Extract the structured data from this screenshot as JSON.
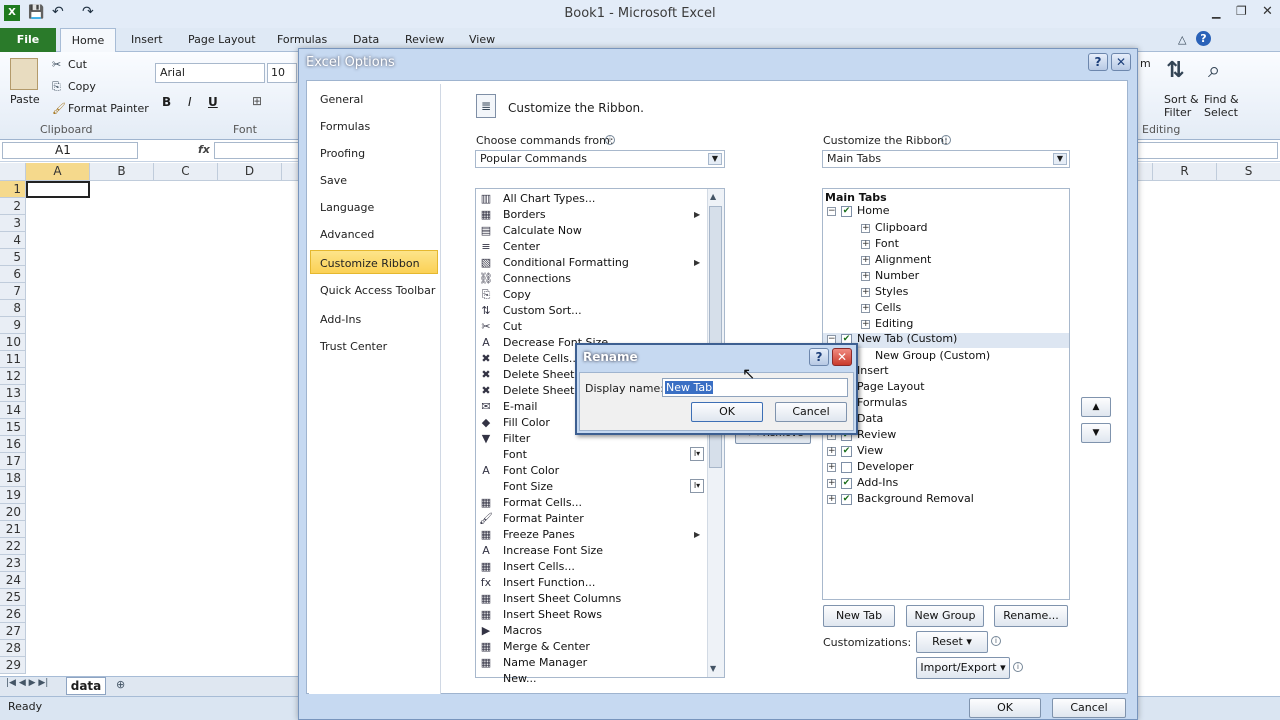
{
  "app": {
    "title": "Book1 - Microsoft Excel",
    "tabs": [
      "File",
      "Home",
      "Insert",
      "Page Layout",
      "Formulas",
      "Data",
      "Review",
      "View"
    ],
    "ribbon": {
      "paste": "Paste",
      "cut": "Cut",
      "copy": "Copy",
      "format_painter": "Format Painter",
      "clipboard_group": "Clipboard",
      "font_name": "Arial",
      "font_size": "10",
      "font_group": "Font",
      "bold": "B",
      "italic": "I",
      "underline": "U",
      "sort_filter_1": "Sort &",
      "sort_filter_2": "Filter",
      "find_select_1": "Find &",
      "find_select_2": "Select",
      "editing_group": "Editing",
      "m_letter": "m"
    },
    "name_box": "A1",
    "fx": "fx",
    "columns": [
      "A",
      "B",
      "C",
      "D"
    ],
    "right_columns": [
      "R",
      "S"
    ],
    "rows": [
      "1",
      "2",
      "3",
      "4",
      "5",
      "6",
      "7",
      "8",
      "9",
      "10",
      "11",
      "12",
      "13",
      "14",
      "15",
      "16",
      "17",
      "18",
      "19",
      "20",
      "21",
      "22",
      "23",
      "24",
      "25",
      "26",
      "27",
      "28",
      "29"
    ],
    "sheet_tab": "data",
    "status": "Ready"
  },
  "options_dialog": {
    "title": "Excel Options",
    "nav": [
      "General",
      "Formulas",
      "Proofing",
      "Save",
      "Language",
      "Advanced",
      "Customize Ribbon",
      "Quick Access Toolbar",
      "Add-Ins",
      "Trust Center"
    ],
    "heading": "Customize the Ribbon.",
    "choose_label": "Choose commands from:",
    "choose_value": "Popular Commands",
    "customize_label": "Customize the Ribbon:",
    "customize_value": "Main Tabs",
    "commands": [
      "All Chart Types...",
      "Borders",
      "Calculate Now",
      "Center",
      "Conditional Formatting",
      "Connections",
      "Copy",
      "Custom Sort...",
      "Cut",
      "Decrease Font Size",
      "Delete Cells...",
      "Delete Sheet Columns",
      "Delete Sheet Rows",
      "E-mail",
      "Fill Color",
      "Filter",
      "Font",
      "Font Color",
      "Font Size",
      "Format Cells...",
      "Format Painter",
      "Freeze Panes",
      "Increase Font Size",
      "Insert Cells...",
      "Insert Function...",
      "Insert Sheet Columns",
      "Insert Sheet Rows",
      "Macros",
      "Merge & Center",
      "Name Manager",
      "New..."
    ],
    "tree_header": "Main Tabs",
    "tree": {
      "home": "Home",
      "home_groups": [
        "Clipboard",
        "Font",
        "Alignment",
        "Number",
        "Styles",
        "Cells",
        "Editing"
      ],
      "new_tab": "New Tab (Custom)",
      "new_group": "New Group (Custom)",
      "insert": "Insert",
      "page_layout": "Page Layout",
      "formulas": "Formulas",
      "data": "Data",
      "review": "Review",
      "view": "View",
      "developer": "Developer",
      "addins": "Add-Ins",
      "background_removal": "Background Removal"
    },
    "remove_button": "<< Remove",
    "new_tab_button": "New Tab",
    "new_group_button": "New Group",
    "rename_button": "Rename...",
    "customizations_label": "Customizations:",
    "reset_button": "Reset ▾",
    "import_export_button": "Import/Export ▾",
    "ok": "OK",
    "cancel": "Cancel"
  },
  "rename_dialog": {
    "title": "Rename",
    "label": "Display name:",
    "value": "New Tab",
    "ok": "OK",
    "cancel": "Cancel",
    "help": "?",
    "close": "✕"
  }
}
